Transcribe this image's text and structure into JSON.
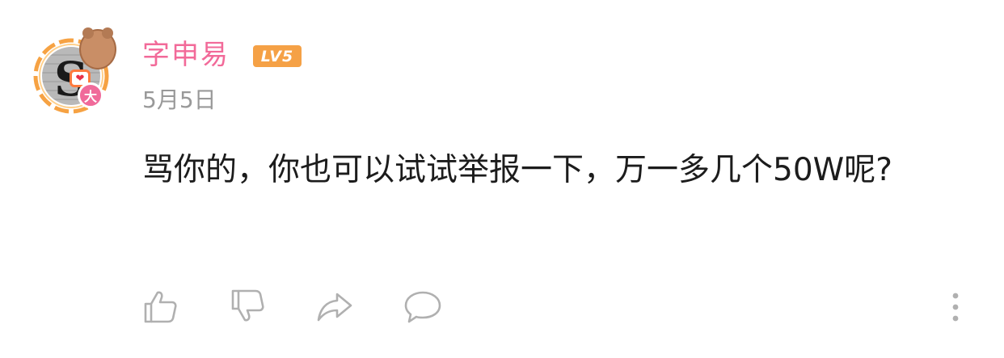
{
  "comment": {
    "username": "字申易",
    "level": "LV5",
    "date": "5月5日",
    "text": "骂你的，你也可以试试举报一下，万一多几个50W呢?",
    "avatar": {
      "initial": "S",
      "badge": "大",
      "pendant_icons": [
        "heart-icon",
        "bear-icon"
      ]
    }
  },
  "actions": [
    {
      "name": "like",
      "icon": "thumbs-up-icon"
    },
    {
      "name": "dislike",
      "icon": "thumbs-down-icon"
    },
    {
      "name": "share",
      "icon": "share-arrow-icon"
    },
    {
      "name": "reply",
      "icon": "comment-bubble-icon"
    },
    {
      "name": "more",
      "icon": "more-vertical-icon"
    }
  ],
  "colors": {
    "username": "#f26a99",
    "level_badge": "#f5a146",
    "meta_text": "#999999",
    "content_text": "#1c1c1c",
    "icon": "#b0b0b0"
  }
}
